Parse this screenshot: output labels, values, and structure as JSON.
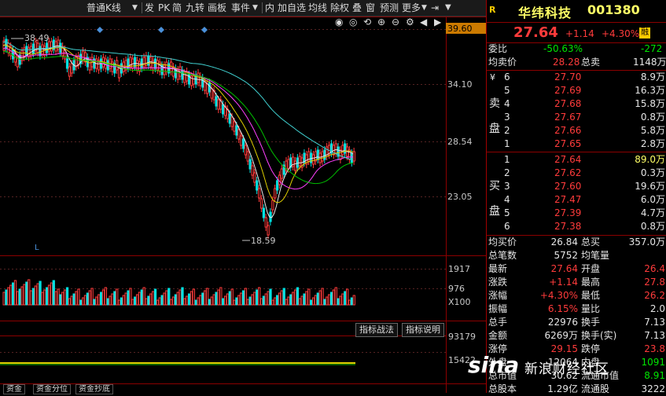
{
  "toolbar": {
    "items": [
      "普通K线",
      "▼",
      "发",
      "PK",
      "简",
      "九转",
      "画板",
      "事件",
      "▼",
      "内",
      "加自选",
      "均线",
      "除权",
      "叠",
      "窗",
      "预测",
      "更多",
      "▼"
    ]
  },
  "chart": {
    "price_labels": [
      "39.60",
      "34.10",
      "28.54",
      "23.05"
    ],
    "high_label": "38.49",
    "low_label": "18.59",
    "vol_labels": [
      "1917",
      "976",
      "X100"
    ],
    "ind_labels": [
      "93179",
      "15422"
    ],
    "ind_buttons": [
      "指标战法",
      "指标说明"
    ],
    "bottom_tabs": [
      "资金",
      "资金分位",
      "资金抄底"
    ],
    "marker_L": "L"
  },
  "quote": {
    "r_icon": "R",
    "name": "华纬科技",
    "code": "001380",
    "price": "27.64",
    "change": "+1.14",
    "change_pct": "+4.30%",
    "badge": "融",
    "weibi_label": "委比",
    "weibi": "-50.63%",
    "weicha": "-272",
    "avg_sell_label": "均卖价",
    "avg_sell": "28.28",
    "total_sell_label": "总卖",
    "total_sell": "1148万",
    "yuan": "¥",
    "sell_side": "卖盘",
    "buy_side": "买盘",
    "sells": [
      {
        "lvl": "6",
        "price": "27.70",
        "vol": "8.9万"
      },
      {
        "lvl": "5",
        "price": "27.69",
        "vol": "16.3万"
      },
      {
        "lvl": "4",
        "price": "27.68",
        "vol": "15.8万"
      },
      {
        "lvl": "3",
        "price": "27.67",
        "vol": "0.8万"
      },
      {
        "lvl": "2",
        "price": "27.66",
        "vol": "5.8万"
      },
      {
        "lvl": "1",
        "price": "27.65",
        "vol": "2.8万"
      }
    ],
    "buys": [
      {
        "lvl": "1",
        "price": "27.64",
        "vol": "89.0万"
      },
      {
        "lvl": "2",
        "price": "27.62",
        "vol": "0.3万"
      },
      {
        "lvl": "3",
        "price": "27.60",
        "vol": "19.6万"
      },
      {
        "lvl": "4",
        "price": "27.47",
        "vol": "6.0万"
      },
      {
        "lvl": "5",
        "price": "27.39",
        "vol": "4.7万"
      },
      {
        "lvl": "6",
        "price": "27.38",
        "vol": "0.8万"
      }
    ],
    "stats": [
      {
        "l1": "均买价",
        "v1": "26.84",
        "l2": "总买",
        "v2": "357.0万"
      },
      {
        "l1": "总笔数",
        "v1": "5752",
        "l2": "均笔量",
        "v2": ""
      },
      {
        "l1": "最新",
        "v1": "27.64",
        "l2": "开盘",
        "v2": "26.4"
      },
      {
        "l1": "涨跌",
        "v1": "+1.14",
        "l2": "最高",
        "v2": "27.8"
      },
      {
        "l1": "涨幅",
        "v1": "+4.30%",
        "l2": "最低",
        "v2": "26.2"
      },
      {
        "l1": "振幅",
        "v1": "6.15%",
        "l2": "量比",
        "v2": "2.0"
      },
      {
        "l1": "总手",
        "v1": "22976",
        "l2": "换手",
        "v2": "7.13"
      },
      {
        "l1": "金额",
        "v1": "6269万",
        "l2": "换手(实)",
        "v2": "7.13"
      },
      {
        "l1": "涨停",
        "v1": "29.15",
        "l2": "跌停",
        "v2": "23.8"
      },
      {
        "l1": "外盘",
        "v1": "12064",
        "l2": "内盘",
        "v2": "1091"
      },
      {
        "l1": "总市值",
        "v1": "30.62",
        "l2": "流通市值",
        "v2": "8.91"
      },
      {
        "l1": "总股本",
        "v1": "1.29亿",
        "l2": "流通股",
        "v2": "3222"
      }
    ]
  },
  "watermark": {
    "logo": "sina",
    "text": "新浪财经社区"
  },
  "colors": {
    "up": "#ff3b3b",
    "down": "#00e600",
    "accent": "#ffff66",
    "border": "#a00000"
  }
}
